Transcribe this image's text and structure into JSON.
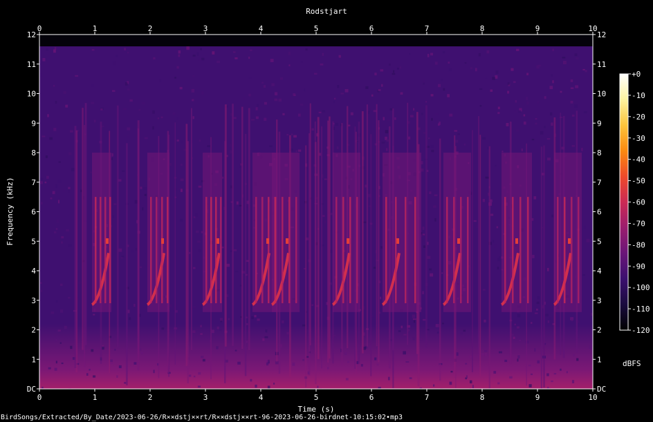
{
  "chart_data": {
    "type": "heatmap",
    "title": "Rodstjart",
    "xlabel": "Time (s)",
    "ylabel": "Frequency (kHz)",
    "x_ticks": [
      "0",
      "1",
      "2",
      "3",
      "4",
      "5",
      "6",
      "7",
      "8",
      "9",
      "10"
    ],
    "y_ticks": [
      "DC",
      "1",
      "2",
      "3",
      "4",
      "5",
      "6",
      "7",
      "8",
      "9",
      "10",
      "11",
      "12"
    ],
    "xlim": [
      0,
      10
    ],
    "ylim": [
      0,
      12
    ],
    "colorbar": {
      "unit": "dBFS",
      "ticks": [
        "+0",
        "-10",
        "-20",
        "-30",
        "-40",
        "-50",
        "-60",
        "-70",
        "-80",
        "-90",
        "-100",
        "-110",
        "-120"
      ],
      "range": [
        -120,
        0
      ],
      "colors": [
        "#000000",
        "#1a0b3e",
        "#3b0f6f",
        "#6a1578",
        "#9b1d6e",
        "#cc2a54",
        "#ee4a2a",
        "#fb8a10",
        "#fcc43c",
        "#fdf3a0",
        "#ffffff"
      ]
    },
    "background_level_db": -95,
    "low_band_level_db": -70,
    "low_band_top_khz": 1.2,
    "calls": [
      {
        "start_s": 0.95,
        "end_s": 1.3
      },
      {
        "start_s": 1.95,
        "end_s": 2.35
      },
      {
        "start_s": 2.95,
        "end_s": 3.3
      },
      {
        "start_s": 3.85,
        "end_s": 4.3
      },
      {
        "start_s": 4.2,
        "end_s": 4.7
      },
      {
        "start_s": 5.3,
        "end_s": 5.8
      },
      {
        "start_s": 6.2,
        "end_s": 6.9
      },
      {
        "start_s": 7.3,
        "end_s": 7.8
      },
      {
        "start_s": 8.35,
        "end_s": 8.9
      },
      {
        "start_s": 9.3,
        "end_s": 9.8
      }
    ],
    "footer_text": "BirdSongs/Extracted/By_Date/2023-06-26/R××dstj××rt/R××dstj××rt-96-2023-06-26-birdnet-10:15:02•mp3"
  }
}
